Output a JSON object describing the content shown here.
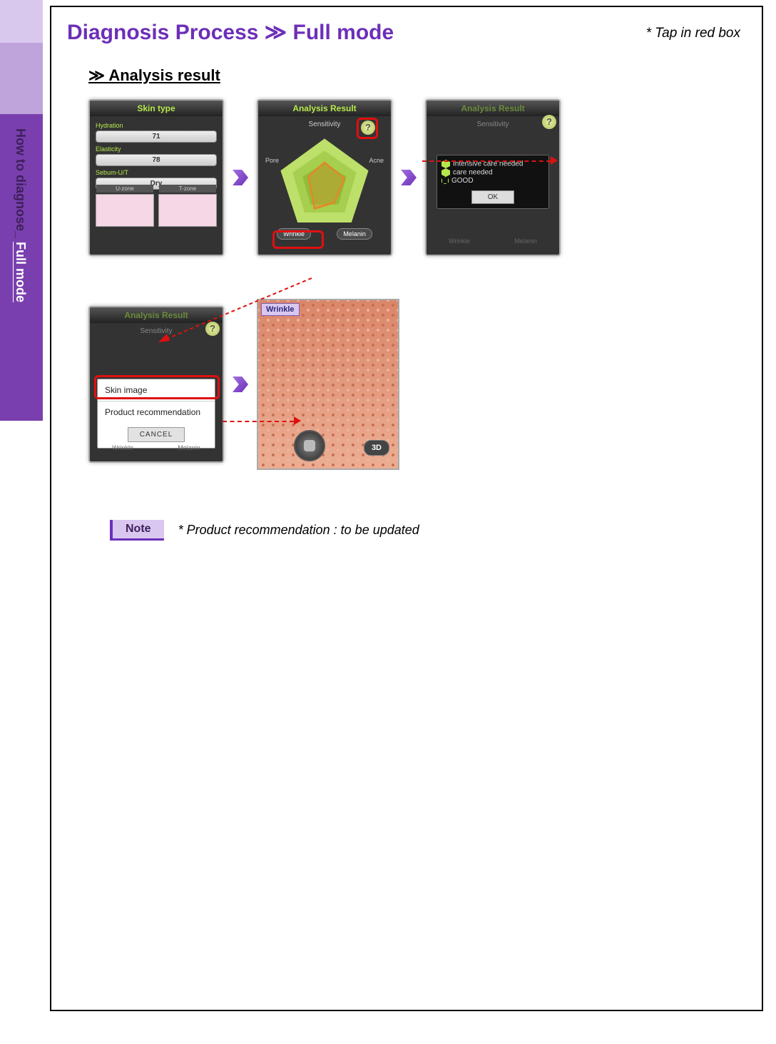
{
  "sidebar": {
    "label_dim": "How to diagnose_ ",
    "label_bright": "Full mode"
  },
  "title": "Diagnosis Process ≫ Full mode",
  "tap_hint": "* Tap in red box",
  "section_title": "≫ Analysis result",
  "panel_skin_type": {
    "header": "Skin type",
    "metrics": {
      "hydration_label": "Hydration",
      "hydration_value": "71",
      "elasticity_label": "Elasticity",
      "elasticity_value": "78",
      "sebum_label": "Sebum-U/T",
      "sebum_value": "Dry"
    },
    "zones": {
      "u": "U-zone",
      "t": "T-zone"
    }
  },
  "panel_analysis": {
    "header": "Analysis Result",
    "labels": {
      "sensitivity": "Sensitivity",
      "pore": "Pore",
      "acne": "Acne",
      "wrinkle": "Wrinkle",
      "melanin": "Melanin"
    },
    "help_glyph": "?"
  },
  "legend_popup": {
    "items": {
      "a": "Intensive care needed",
      "b": "care needed",
      "c": "GOOD"
    },
    "ok": "OK"
  },
  "longpress_popup": {
    "skin_image": "Skin image",
    "product_rec": "Product recommendation",
    "cancel": "CANCEL"
  },
  "skin_image_panel": {
    "tag": "Wrinkle",
    "button3d": "3D"
  },
  "note": {
    "badge": "Note",
    "text": "* Product recommendation : to be updated"
  }
}
